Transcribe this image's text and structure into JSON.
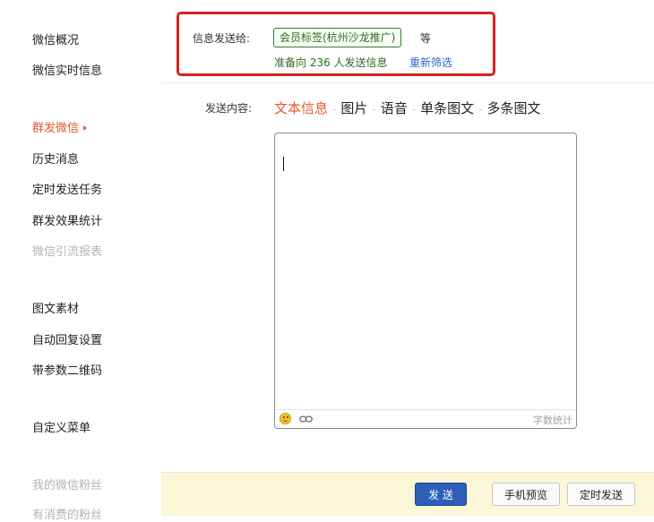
{
  "sidebar": {
    "items": [
      {
        "label": "微信概况",
        "state": "normal"
      },
      {
        "label": "微信实时信息",
        "state": "normal"
      },
      {
        "label": "群发微信",
        "state": "active"
      },
      {
        "label": "历史消息",
        "state": "normal"
      },
      {
        "label": "定时发送任务",
        "state": "normal"
      },
      {
        "label": "群发效果统计",
        "state": "normal"
      },
      {
        "label": "微信引流报表",
        "state": "disabled"
      },
      {
        "label": "图文素材",
        "state": "normal"
      },
      {
        "label": "自动回复设置",
        "state": "normal"
      },
      {
        "label": "带参数二维码",
        "state": "normal"
      },
      {
        "label": "自定义菜单",
        "state": "normal"
      },
      {
        "label": "我的微信粉丝",
        "state": "disabled"
      },
      {
        "label": "有消费的粉丝",
        "state": "disabled"
      }
    ]
  },
  "recipients": {
    "label": "信息发送给:",
    "tag": "会员标签(杭州沙龙推广)",
    "etc": "等",
    "count_text": "准备向 236 人发送信息",
    "refilter": "重新筛选"
  },
  "content": {
    "label": "发送内容:",
    "tabs": [
      {
        "label": "文本信息",
        "active": true
      },
      {
        "label": "图片",
        "active": false
      },
      {
        "label": "语音",
        "active": false
      },
      {
        "label": "单条图文",
        "active": false
      },
      {
        "label": "多条图文",
        "active": false
      }
    ],
    "separator": "-",
    "editor": {
      "value": "",
      "char_count_label": "字数统计",
      "toolbar_icons": [
        "emoji-icon",
        "link-icon"
      ]
    }
  },
  "actions": {
    "send": "发 送",
    "preview": "手机预览",
    "schedule": "定时发送"
  },
  "colors": {
    "accent": "#e05a2b",
    "highlight_border": "#d4231d",
    "tag_green": "#2e6b1e",
    "link_blue": "#2a6bc9",
    "primary_button": "#2d5fb8",
    "bottom_bar": "#fbf7d8"
  }
}
